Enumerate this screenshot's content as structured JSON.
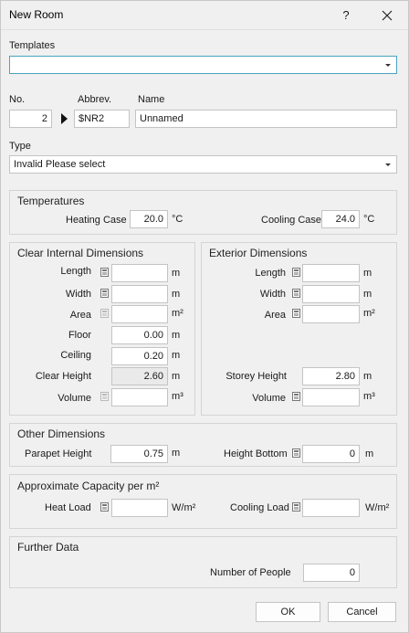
{
  "window": {
    "title": "New Room",
    "help": "?"
  },
  "templates": {
    "label": "Templates",
    "value": ""
  },
  "room": {
    "no_label": "No.",
    "abbrev_label": "Abbrev.",
    "name_label": "Name",
    "no": "2",
    "abbrev": "$NR2",
    "name": "Unnamed"
  },
  "type": {
    "label": "Type",
    "value": "Invalid  Please select"
  },
  "temperatures": {
    "title": "Temperatures",
    "heating_label": "Heating Case",
    "heating_value": "20.0",
    "heating_unit": "°C",
    "cooling_label": "Cooling Case",
    "cooling_value": "24.0",
    "cooling_unit": "°C"
  },
  "clear_internal": {
    "title": "Clear Internal Dimensions",
    "length_label": "Length",
    "length_value": "",
    "length_unit": "m",
    "width_label": "Width",
    "width_value": "",
    "width_unit": "m",
    "area_label": "Area",
    "area_value": "",
    "area_unit": "m²",
    "floor_label": "Floor",
    "floor_value": "0.00",
    "floor_unit": "m",
    "ceiling_label": "Ceiling",
    "ceiling_value": "0.20",
    "ceiling_unit": "m",
    "clear_height_label": "Clear Height",
    "clear_height_value": "2.60",
    "clear_height_unit": "m",
    "volume_label": "Volume",
    "volume_value": "",
    "volume_unit": "m³"
  },
  "exterior": {
    "title": "Exterior Dimensions",
    "length_label": "Length",
    "length_value": "",
    "length_unit": "m",
    "width_label": "Width",
    "width_value": "",
    "width_unit": "m",
    "area_label": "Area",
    "area_value": "",
    "area_unit": "m²",
    "storey_height_label": "Storey Height",
    "storey_height_value": "2.80",
    "storey_height_unit": "m",
    "volume_label": "Volume",
    "volume_value": "",
    "volume_unit": "m³"
  },
  "other": {
    "title": "Other Dimensions",
    "parapet_label": "Parapet Height",
    "parapet_value": "0.75",
    "parapet_unit": "m",
    "height_bottom_label": "Height Bottom",
    "height_bottom_value": "0",
    "height_bottom_unit": "m"
  },
  "capacity": {
    "title": "Approximate Capacity per m²",
    "heat_label": "Heat Load",
    "heat_value": "",
    "heat_unit": "W/m²",
    "cooling_label": "Cooling Load",
    "cooling_value": "",
    "cooling_unit": "W/m²"
  },
  "further": {
    "title": "Further Data",
    "people_label": "Number of People",
    "people_value": "0"
  },
  "buttons": {
    "ok": "OK",
    "cancel": "Cancel"
  }
}
